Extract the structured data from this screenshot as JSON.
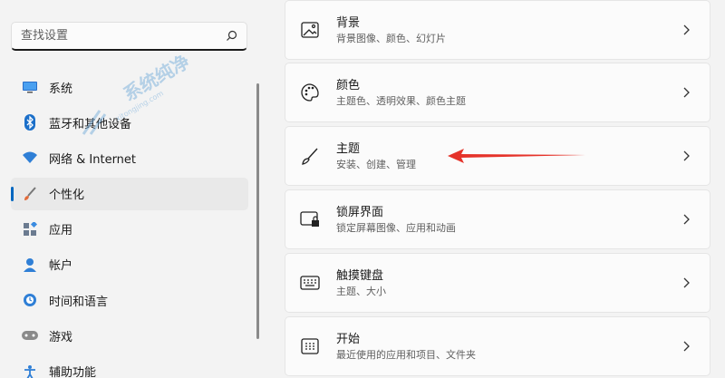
{
  "search": {
    "placeholder": "查找设置"
  },
  "sidebar": {
    "items": [
      {
        "label": "系统",
        "icon": "monitor-icon"
      },
      {
        "label": "蓝牙和其他设备",
        "icon": "bluetooth-icon"
      },
      {
        "label": "网络 & Internet",
        "icon": "wifi-icon"
      },
      {
        "label": "个性化",
        "icon": "brush-icon",
        "active": true
      },
      {
        "label": "应用",
        "icon": "apps-icon"
      },
      {
        "label": "帐户",
        "icon": "account-icon"
      },
      {
        "label": "时间和语言",
        "icon": "clock-globe-icon"
      },
      {
        "label": "游戏",
        "icon": "gamepad-icon"
      },
      {
        "label": "辅助功能",
        "icon": "accessibility-icon"
      }
    ]
  },
  "cards": [
    {
      "title": "背景",
      "subtitle": "背景图像、颜色、幻灯片",
      "icon": "image-icon"
    },
    {
      "title": "颜色",
      "subtitle": "主题色、透明效果、颜色主题",
      "icon": "palette-icon"
    },
    {
      "title": "主题",
      "subtitle": "安装、创建、管理",
      "icon": "brush-icon"
    },
    {
      "title": "锁屏界面",
      "subtitle": "锁定屏幕图像、应用和动画",
      "icon": "lock-screen-icon"
    },
    {
      "title": "触摸键盘",
      "subtitle": "主题、大小",
      "icon": "keyboard-icon"
    },
    {
      "title": "开始",
      "subtitle": "最近使用的应用和项目、文件夹",
      "icon": "start-icon"
    }
  ],
  "watermark": {
    "text": "系统纯净",
    "sub": "xitongjing.com"
  },
  "colors": {
    "accent": "#0067c0",
    "annotation": "#e5332a"
  }
}
